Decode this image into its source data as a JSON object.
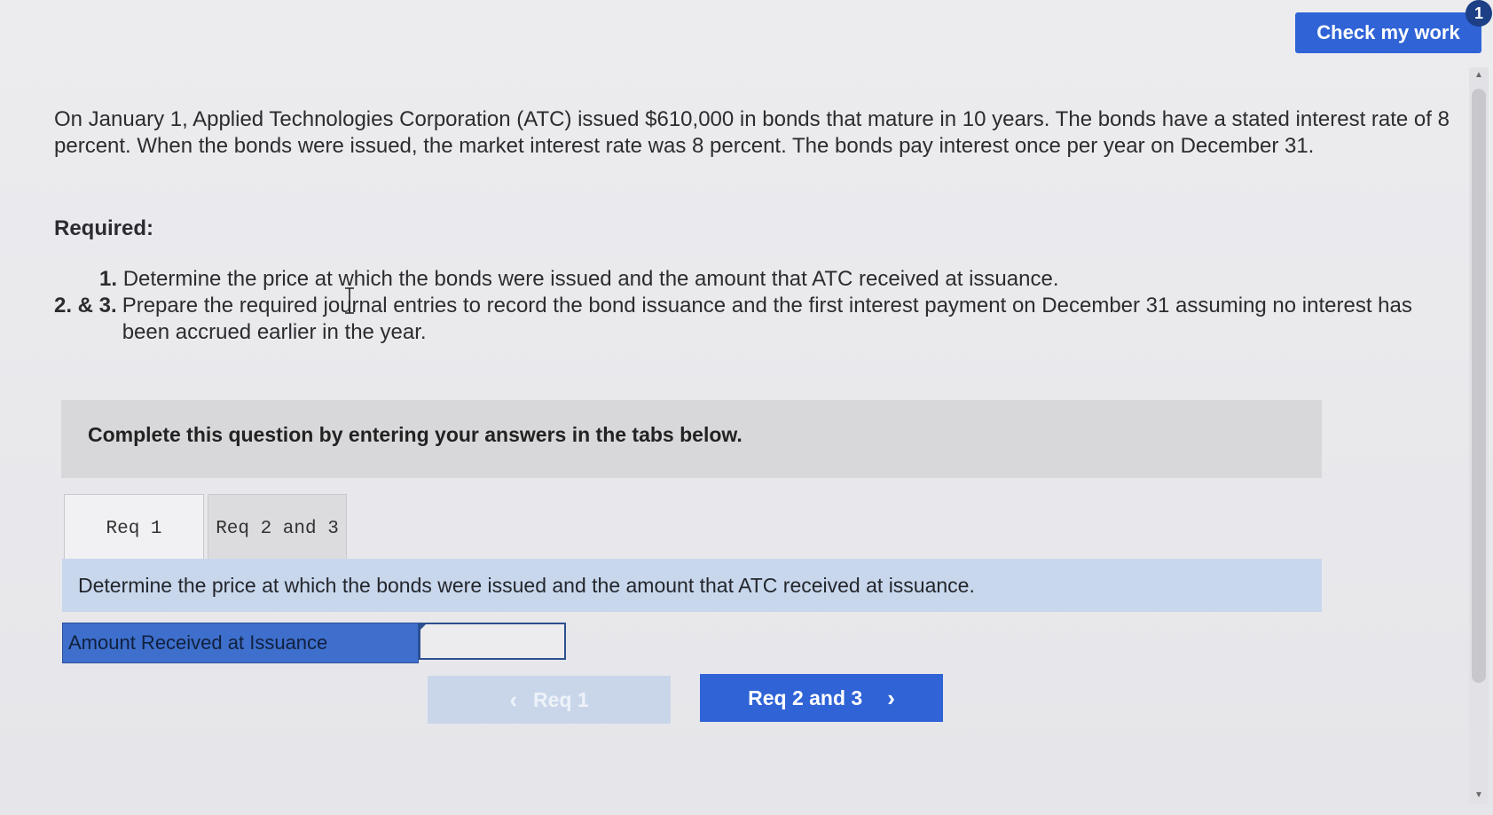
{
  "header": {
    "check_label": "Check my work",
    "check_badge": "1"
  },
  "problem": {
    "text": "On January 1, Applied Technologies Corporation (ATC) issued $610,000 in bonds that mature in 10 years. The bonds have a stated interest rate of 8 percent. When the bonds were issued, the market interest rate was 8 percent. The bonds pay interest once per year on December 31."
  },
  "required": {
    "title": "Required:",
    "items": [
      {
        "num": "1.",
        "text": "Determine the price at which the bonds were issued and the amount that ATC received at issuance."
      },
      {
        "num": "2. & 3.",
        "text": "Prepare the required journal entries to record the bond issuance and the first interest payment on December 31 assuming no interest has been accrued earlier in the year."
      }
    ]
  },
  "instruction": "Complete this question by entering your answers in the tabs below.",
  "tabs": [
    {
      "label": "Req 1",
      "active": true
    },
    {
      "label": "Req 2 and 3",
      "active": false
    }
  ],
  "question": "Determine the price at which the bonds were issued and the amount that ATC received at issuance.",
  "answer": {
    "label": "Amount Received at Issuance",
    "value": ""
  },
  "nav": {
    "prev_label": "Req 1",
    "next_label": "Req 2 and 3"
  },
  "colors": {
    "primary": "#2f63d6",
    "question_bg": "#c8d7ec",
    "answer_label_bg": "#3f6fcc"
  },
  "icons": {
    "prev": "chevron-left-icon",
    "next": "chevron-right-icon",
    "cursor": "text-cursor-icon"
  }
}
